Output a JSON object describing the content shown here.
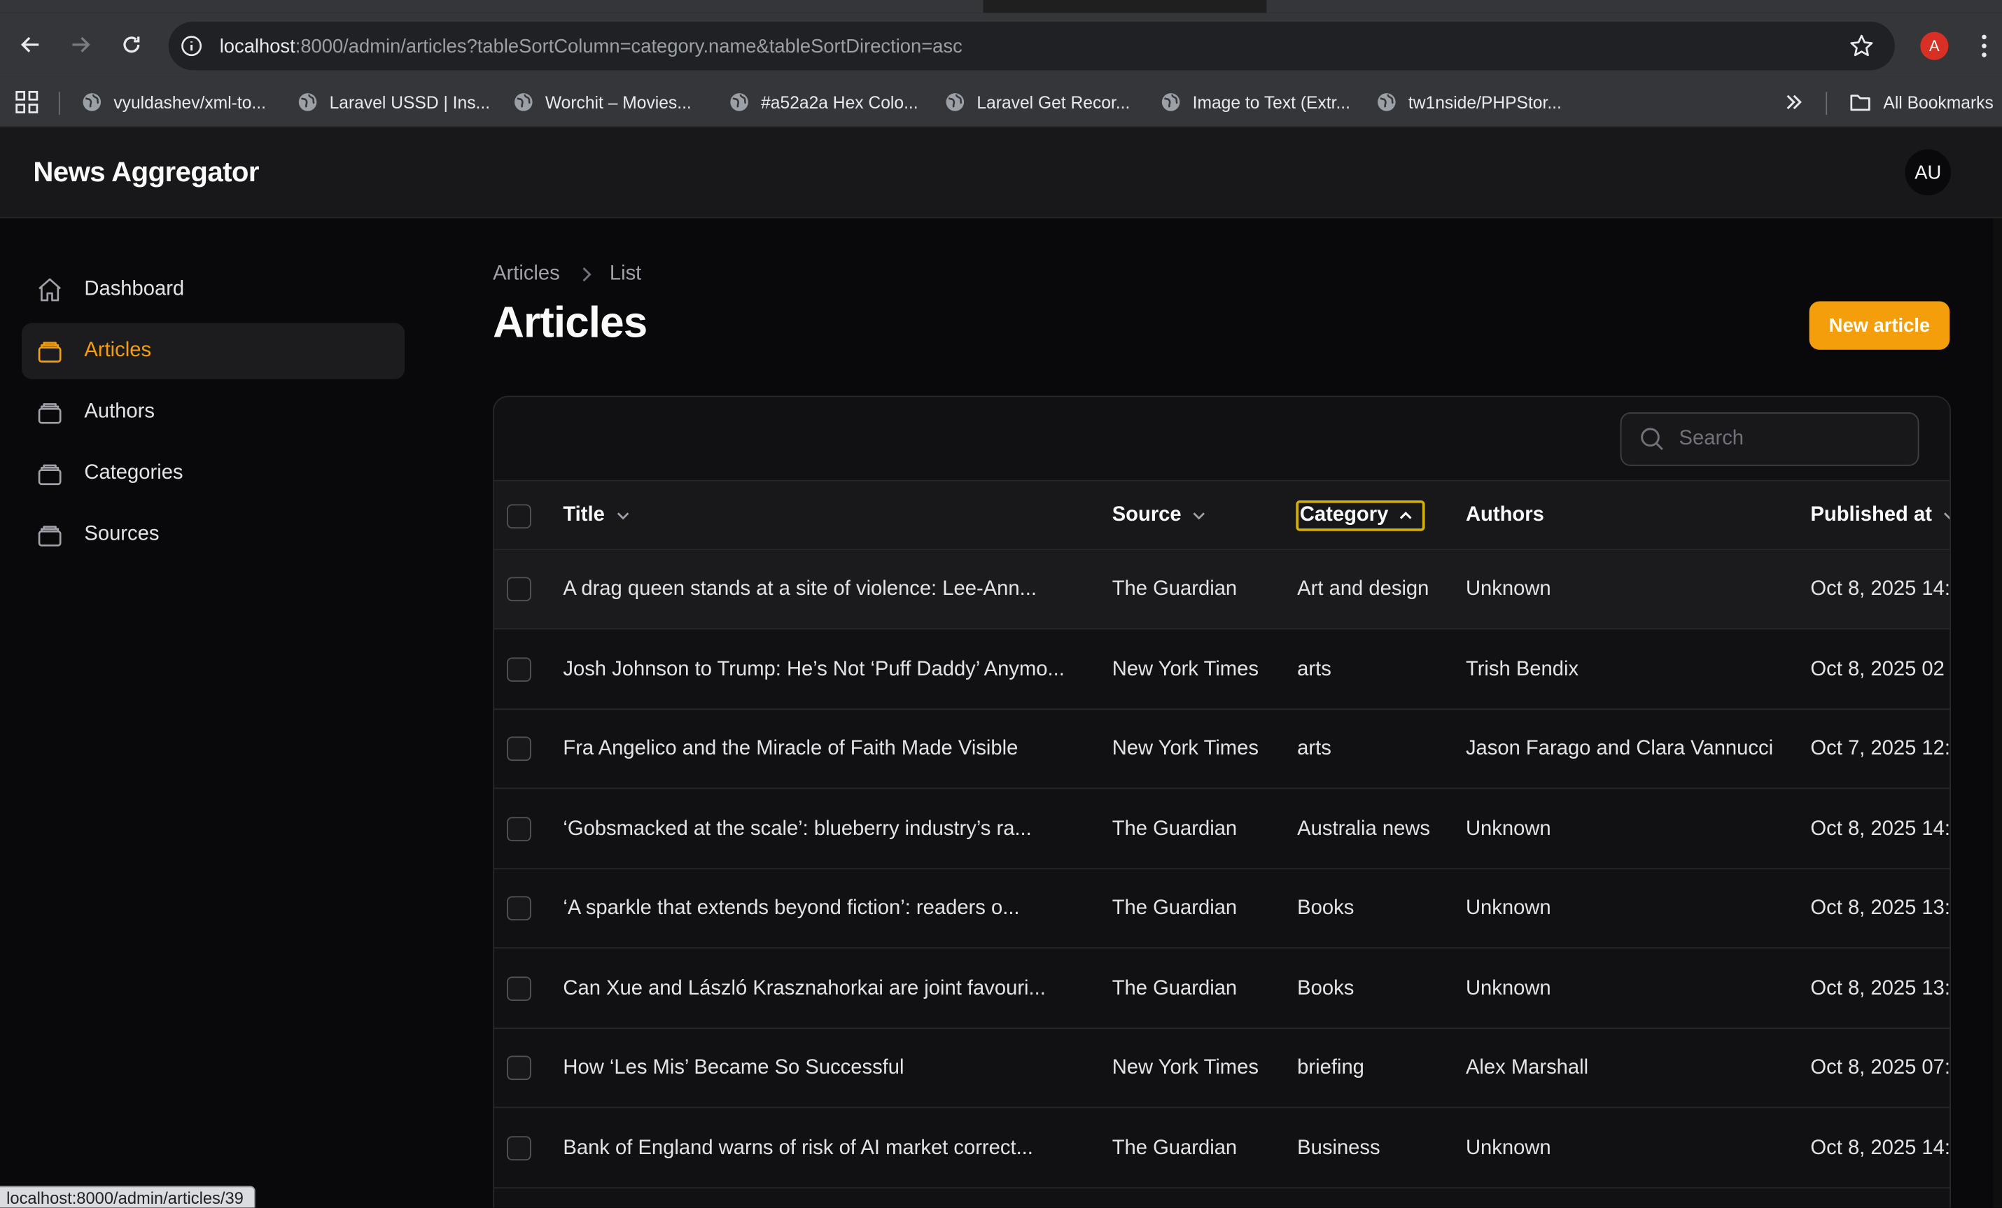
{
  "browser": {
    "url_host": "localhost",
    "url_rest": ":8000/admin/articles?tableSortColumn=category.name&tableSortDirection=asc",
    "profile_initial": "A",
    "bookmarks": [
      "vyuldashev/xml-to...",
      "Laravel USSD | Ins...",
      "Worchit – Movies...",
      "#a52a2a Hex Colo...",
      "Laravel Get Recor...",
      "Image to Text (Extr...",
      "tw1nside/PHPStor..."
    ],
    "all_bookmarks": "All Bookmarks",
    "status_url": "localhost:8000/admin/articles/39"
  },
  "app": {
    "brand": "News Aggregator",
    "avatar": "AU"
  },
  "sidebar": {
    "items": [
      {
        "label": "Dashboard",
        "icon": "home-icon",
        "active": false
      },
      {
        "label": "Articles",
        "icon": "collection-icon",
        "active": true
      },
      {
        "label": "Authors",
        "icon": "collection-icon",
        "active": false
      },
      {
        "label": "Categories",
        "icon": "collection-icon",
        "active": false
      },
      {
        "label": "Sources",
        "icon": "collection-icon",
        "active": false
      }
    ]
  },
  "page": {
    "breadcrumb": [
      "Articles",
      "List"
    ],
    "title": "Articles",
    "new_button": "New article"
  },
  "table": {
    "search_placeholder": "Search",
    "columns": [
      "Title",
      "Source",
      "Category",
      "Authors",
      "Published at"
    ],
    "sort": {
      "column": "Category",
      "direction": "asc"
    },
    "rows": [
      {
        "title": "A drag queen stands at a site of violence: Lee-Ann...",
        "source": "The Guardian",
        "category": "Art and design",
        "authors": "Unknown",
        "published": "Oct 8, 2025 14:"
      },
      {
        "title": "Josh Johnson to Trump: He’s Not ‘Puff Daddy’ Anymo...",
        "source": "New York Times",
        "category": "arts",
        "authors": "Trish Bendix",
        "published": "Oct 8, 2025 02"
      },
      {
        "title": "Fra Angelico and the Miracle of Faith Made Visible",
        "source": "New York Times",
        "category": "arts",
        "authors": "Jason Farago and Clara Vannucci",
        "published": "Oct 7, 2025 12:("
      },
      {
        "title": "‘Gobsmacked at the scale’: blueberry industry’s ra...",
        "source": "The Guardian",
        "category": "Australia news",
        "authors": "Unknown",
        "published": "Oct 8, 2025 14:"
      },
      {
        "title": "‘A sparkle that extends beyond fiction’: readers o...",
        "source": "The Guardian",
        "category": "Books",
        "authors": "Unknown",
        "published": "Oct 8, 2025 13:"
      },
      {
        "title": "Can Xue and László Krasznahorkai are joint favouri...",
        "source": "The Guardian",
        "category": "Books",
        "authors": "Unknown",
        "published": "Oct 8, 2025 13:"
      },
      {
        "title": "How ‘Les Mis’ Became So Successful",
        "source": "New York Times",
        "category": "briefing",
        "authors": "Alex Marshall",
        "published": "Oct 8, 2025 07:"
      },
      {
        "title": "Bank of England warns of risk of AI market correct...",
        "source": "The Guardian",
        "category": "Business",
        "authors": "Unknown",
        "published": "Oct 8, 2025 14:"
      }
    ]
  },
  "colors": {
    "accent": "#f59e0b",
    "background": "#09090b",
    "surface": "#18181b",
    "border": "#27272a",
    "sort_focus": "#d4b106"
  }
}
